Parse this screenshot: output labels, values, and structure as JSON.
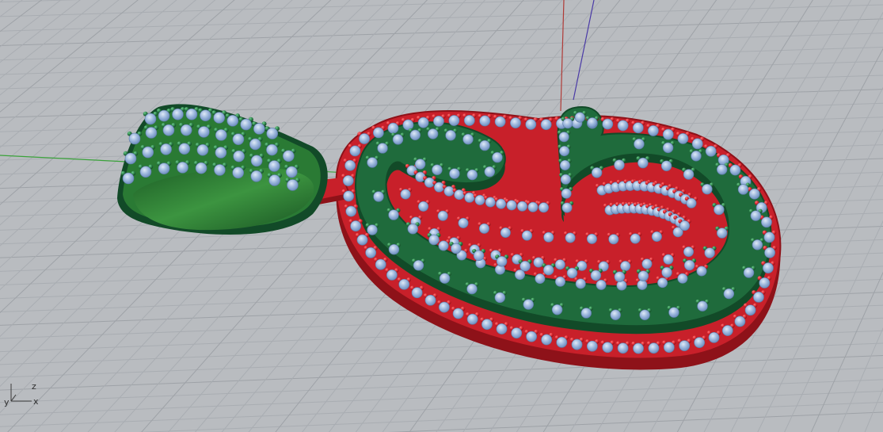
{
  "viewport": {
    "name": "Perspective",
    "colors": {
      "background": "#b9bcc0",
      "grid_minor": "#a9adb2",
      "grid_major": "#9ea2a7",
      "x_axis": "#3aa23a",
      "y_axis": "#b03a36",
      "z_axis": "#4a3aa6"
    },
    "axis_widget": {
      "x_label": "x",
      "y_label": "y",
      "z_label": "z"
    }
  },
  "model": {
    "description_objects": [
      "pendant-body",
      "bail",
      "stones"
    ],
    "colors": {
      "base_metal": "#c8202a",
      "base_metal_dark": "#8e1219",
      "letter_metal": "#1f6b3c",
      "letter_metal_dark": "#124a28",
      "bail_metal": "#2a7a34",
      "bead_red": "#d8232c",
      "bead_green": "#2a7c45",
      "stone": "#9bb6dc",
      "stone_highlight": "#cfe0f4"
    }
  }
}
